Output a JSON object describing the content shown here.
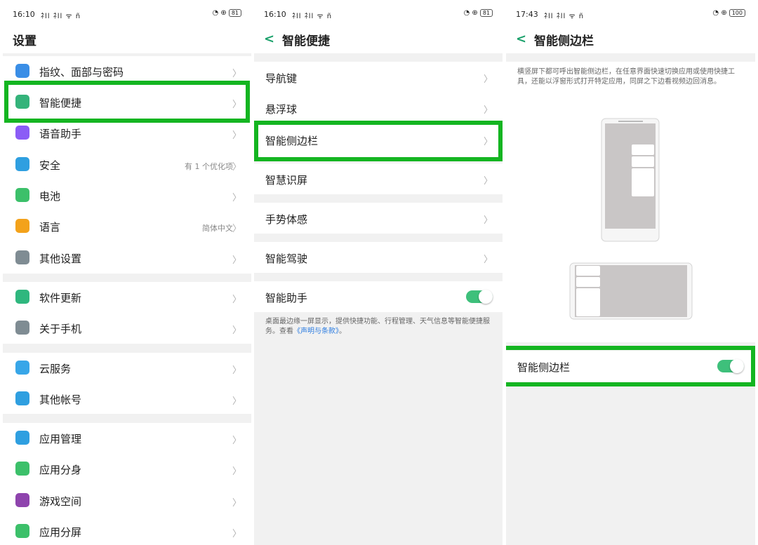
{
  "panel1": {
    "status": {
      "time": "16:10",
      "signal": "ﾈll ﾈll ᯤ ñ",
      "battery": "81"
    },
    "title": "设置",
    "items": [
      {
        "label": "指纹、面部与密码",
        "value": "",
        "icon": "fingerprint-face-icon",
        "color": "#3a8ee6"
      },
      {
        "label": "智能便捷",
        "value": "",
        "icon": "smart-assist-icon",
        "color": "#34b37a"
      },
      {
        "label": "语音助手",
        "value": "",
        "icon": "microphone-icon",
        "color": "#8b5cf6"
      },
      {
        "label": "安全",
        "value": "有 1 个优化项",
        "icon": "shield-icon",
        "color": "#2f9fe0"
      },
      {
        "label": "电池",
        "value": "",
        "icon": "battery-icon",
        "color": "#3cc06a"
      },
      {
        "label": "语言",
        "value": "简体中文",
        "icon": "language-icon",
        "color": "#f3a21b"
      },
      {
        "label": "其他设置",
        "value": "",
        "icon": "gear-icon",
        "color": "#7f8c93"
      },
      {
        "label": "软件更新",
        "value": "",
        "icon": "update-icon",
        "color": "#2fb77e"
      },
      {
        "label": "关于手机",
        "value": "",
        "icon": "info-icon",
        "color": "#7f8c93"
      },
      {
        "label": "云服务",
        "value": "",
        "icon": "cloud-icon",
        "color": "#38a6e8"
      },
      {
        "label": "其他帐号",
        "value": "",
        "icon": "account-icon",
        "color": "#2f9fe0"
      },
      {
        "label": "应用管理",
        "value": "",
        "icon": "app-grid-icon",
        "color": "#2f9fe0"
      },
      {
        "label": "应用分身",
        "value": "",
        "icon": "app-clone-icon",
        "color": "#3cc06a"
      },
      {
        "label": "游戏空间",
        "value": "",
        "icon": "game-space-icon",
        "color": "#8e44ad"
      },
      {
        "label": "应用分屏",
        "value": "",
        "icon": "split-screen-icon",
        "color": "#3cc06a"
      }
    ]
  },
  "panel2": {
    "status": {
      "time": "16:10",
      "signal": "ﾈll ﾈll ᯤ ñ",
      "battery": "81"
    },
    "title": "智能便捷",
    "items": [
      {
        "label": "导航键"
      },
      {
        "label": "悬浮球"
      },
      {
        "label": "智能侧边栏"
      },
      {
        "label": "智慧识屏"
      },
      {
        "label": "手势体感"
      },
      {
        "label": "智能驾驶"
      },
      {
        "label": "智能助手"
      }
    ],
    "assistant_desc": "桌面最边缘一屏显示，提供快捷功能、行程管理、天气信息等智能便捷服务。查看",
    "assistant_link": "《声明与条款》",
    "assistant_desc_end": "。",
    "assistant_toggle": true
  },
  "panel3": {
    "status": {
      "time": "17:43",
      "signal": "ﾈll ﾈll ᯤ ñ",
      "battery": "100"
    },
    "title": "智能侧边栏",
    "description": "横竖屏下都可呼出智能侧边栏，在任意界面快速切换应用或使用快捷工具，还能以浮窗形式打开特定应用，同屏之下边看视频边回消息。",
    "toggle_label": "智能侧边栏",
    "toggle_on": true
  },
  "colors": {
    "highlight": "#14b521",
    "accent": "#19a06a",
    "toggle": "#3ec07b"
  }
}
